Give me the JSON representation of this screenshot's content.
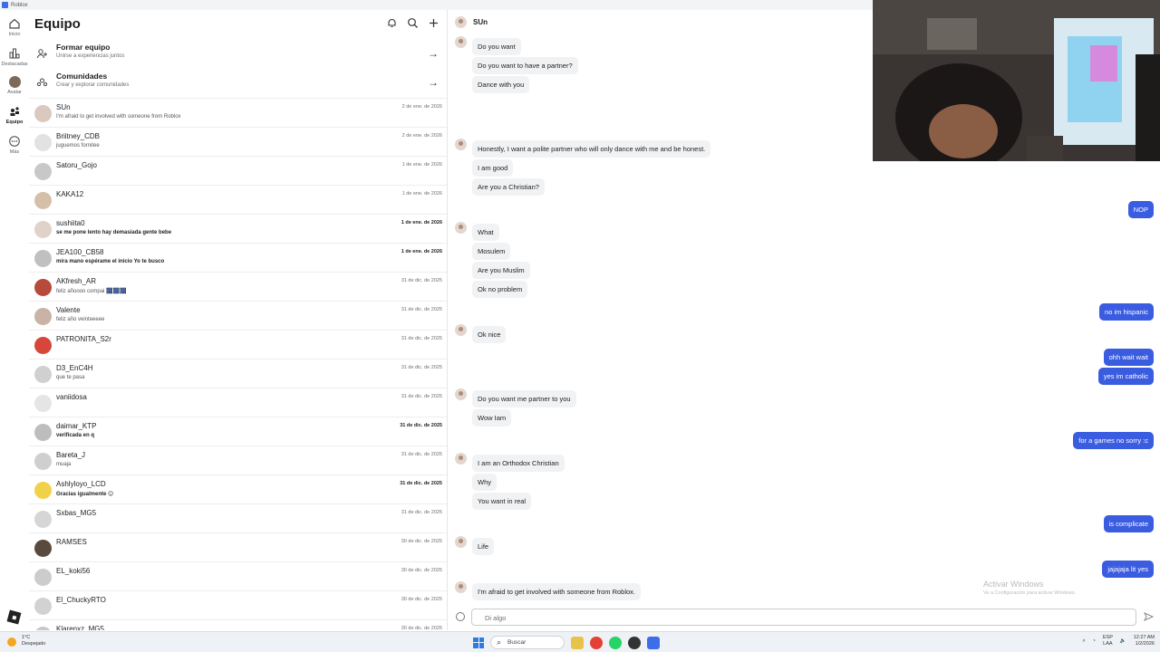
{
  "window": {
    "title": "Roblox"
  },
  "rail": {
    "items": [
      {
        "label": "Inicio"
      },
      {
        "label": "Destacadas"
      },
      {
        "label": "Avatar"
      },
      {
        "label": "Equipo"
      },
      {
        "label": "Más"
      }
    ]
  },
  "panel": {
    "title": "Equipo",
    "actions": [
      {
        "title": "Formar equipo",
        "subtitle": "Unirse a experiencias juntos"
      },
      {
        "title": "Comunidades",
        "subtitle": "Crear y explorar comunidades"
      }
    ],
    "chats": [
      {
        "name": "SUn",
        "preview": "I'm afraid to get involved with someone from Roblox",
        "date": "2 de ene. de 2026"
      },
      {
        "name": "Briitney_CDB",
        "preview": "juguemos fornitee",
        "date": "2 de ene. de 2026"
      },
      {
        "name": "Satoru_Gojo",
        "preview": "",
        "date": "1 de ene. de 2026"
      },
      {
        "name": "KAKA12",
        "preview": "",
        "date": "1 de ene. de 2026"
      },
      {
        "name": "sushiita0",
        "preview": "se me pone lento hay demasiada gente bebe",
        "date": "1 de ene. de 2026"
      },
      {
        "name": "JEA100_CB58",
        "preview": "mira mano espérame el inicio Yo te busco",
        "date": "1 de ene. de 2026"
      },
      {
        "name": "AKfresh_AR",
        "preview": "feliz añoooo compai 🎆🎆🎆",
        "date": "31 de dic. de 2025"
      },
      {
        "name": "Valente",
        "preview": "feliz año veinteeeee",
        "date": "31 de dic. de 2025"
      },
      {
        "name": "PATRONITA_S2r",
        "preview": "",
        "date": "31 de dic. de 2025"
      },
      {
        "name": "D3_EnC4H",
        "preview": "que te pasa",
        "date": "31 de dic. de 2025"
      },
      {
        "name": "vaniidosa",
        "preview": "",
        "date": "31 de dic. de 2025"
      },
      {
        "name": "daimar_KTP",
        "preview": "verificada en q",
        "date": "31 de dic. de 2025"
      },
      {
        "name": "Bareta_J",
        "preview": "muaja",
        "date": "31 de dic. de 2025"
      },
      {
        "name": "Ashlyloyo_LCD",
        "preview": "Gracias igualmente 😊",
        "date": "31 de dic. de 2025"
      },
      {
        "name": "Sxbas_MG5",
        "preview": "",
        "date": "31 de dic. de 2025"
      },
      {
        "name": "RAMSES",
        "preview": "",
        "date": "30 de dic. de 2025"
      },
      {
        "name": "EL_koki56",
        "preview": "",
        "date": "30 de dic. de 2025"
      },
      {
        "name": "El_ChuckyRTO",
        "preview": "",
        "date": "30 de dic. de 2025"
      },
      {
        "name": "Klarenxz_MG5",
        "preview": "",
        "date": "30 de dic. de 2025"
      }
    ]
  },
  "conversation": {
    "contact": "SUn",
    "messages": {
      "m1": "Do you want",
      "m2": "Do you want to have a partner?",
      "m3": "Dance with you",
      "m4": "Honestly, I want a polite partner who will only dance with me and be honest.",
      "m5": "I am good",
      "m6": "Are you a Christian?",
      "m7": "NOP",
      "m8": "What",
      "m9": "Mosulem",
      "m10": "Are you Muslim",
      "m11": "Ok no problem",
      "m12": "no im hispanic",
      "m13": "Ok nice",
      "m14": "ohh wait wait",
      "m15": "yes im catholic",
      "m16": "Do you want me partner to you",
      "m17": "Wow Iam",
      "m18": "for a games no sorry :c",
      "m19": "I am an Orthodox Christian",
      "m20": "Why",
      "m21": "You want in real",
      "m22": "is complicate",
      "m23": "Life",
      "m24": "jajajaja lit yes",
      "m25": "I'm afraid to get involved with someone from Roblox."
    },
    "composer_placeholder": "Di algo"
  },
  "watermark": {
    "title": "Activar Windows",
    "subtitle": "Ve a Configuración para activar Windows."
  },
  "taskbar": {
    "weather_temp": "1°C",
    "weather_desc": "Despejado",
    "search": "Buscar",
    "lang1": "ESP",
    "lang2": "LAA",
    "time": "12:27 AM",
    "date": "1/2/2026"
  },
  "colors": {
    "accent": "#3a5ce0",
    "bubble_in": "#f1f2f4"
  }
}
